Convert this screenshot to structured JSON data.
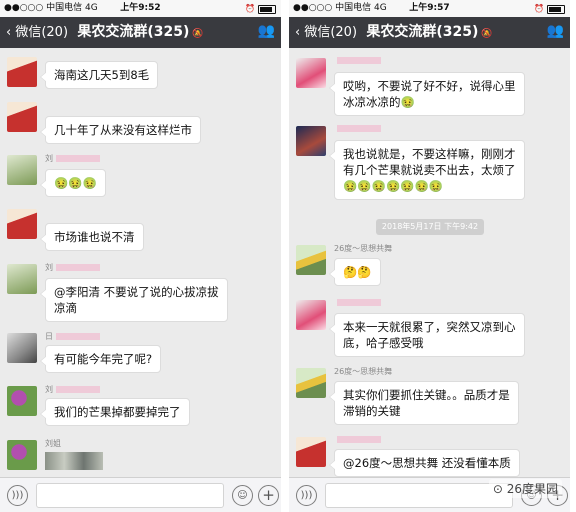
{
  "left": {
    "status": {
      "carrier": "●●○○○ 中国电信  4G",
      "time": "上午9:52"
    },
    "nav": {
      "back": "微信(20)",
      "title": "果农交流群(325)"
    },
    "messages": [
      {
        "text": "海南这几天5到8毛"
      },
      {
        "text": "几十年了从来没有这样烂市"
      },
      {
        "sender": "刘",
        "text": "🤢🤢🤢"
      },
      {
        "text": "市场谁也说不清"
      },
      {
        "sender": "刘",
        "text": "@李阳清 不要说了说的心拔凉拔\n凉滴"
      },
      {
        "sender": "日",
        "text": "有可能今年完了呢?"
      },
      {
        "sender": "刘",
        "text": "我们的芒果掉都要掉完了"
      },
      {
        "sender": "刘姐"
      }
    ]
  },
  "right": {
    "status": {
      "carrier": "●●○○○ 中国电信  4G",
      "time": "上午9:57"
    },
    "nav": {
      "back": "微信(20)",
      "title": "果农交流群(325)"
    },
    "timestamp": "2018年5月17日 下午9:42",
    "messages": [
      {
        "text": "哎哟，不要说了好不好，说得心里\n冰凉冰凉的🤢"
      },
      {
        "text": "我也说就是，不要这样嘛，刚刚才\n有几个芒果就说卖不出去，太烦了\n🤢🤢🤢🤢🤢🤢🤢"
      },
      {
        "sender": "26度～思想共舞",
        "text": "🤔🤔"
      },
      {
        "text": "本来一天就很累了，突然又凉到心\n底，哈子感受哦"
      },
      {
        "sender": "26度～思想共舞",
        "text": "其实你们要抓住关键。。品质才是\n滞销的关键"
      },
      {
        "text": "@26度～思想共舞 还没看懂本质"
      }
    ],
    "watermark": "⊙ 26度果园"
  },
  "icons": {
    "back": "chevron-left-icon",
    "people": "group-info-icon",
    "voice": "voice-icon",
    "emoji": "emoji-icon",
    "plus": "plus-icon",
    "mute": "mute-bell-icon"
  },
  "colors": {
    "nav_bg": "#393a3f",
    "chat_bg": "#ebebeb",
    "bubble_bg": "#ffffff"
  }
}
